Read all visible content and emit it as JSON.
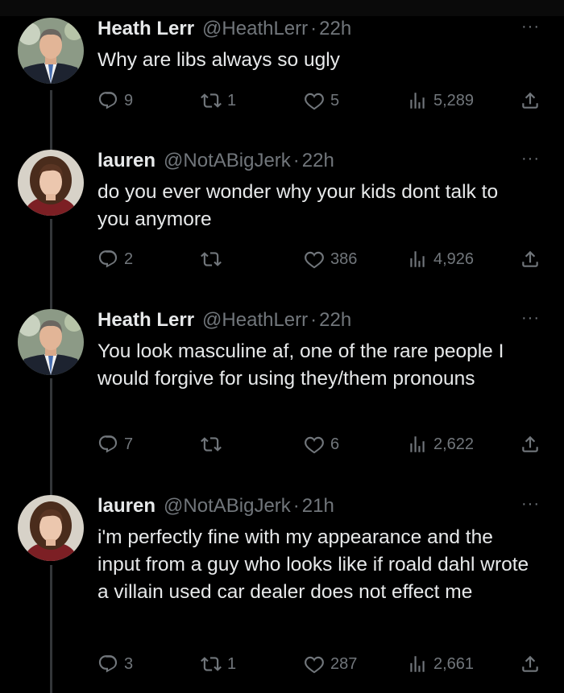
{
  "tweets": [
    {
      "name": "Heath Lerr",
      "handle": "@HeathLerr",
      "separator": "·",
      "time": "22h",
      "more": "···",
      "text": "Why are libs always so ugly",
      "replies": "9",
      "retweets": "1",
      "likes": "5",
      "views": "5,289"
    },
    {
      "name": "lauren",
      "handle": "@NotABigJerk",
      "separator": "·",
      "time": "22h",
      "more": "···",
      "text": "do you ever wonder why your kids dont talk to you anymore",
      "replies": "2",
      "retweets": "",
      "likes": "386",
      "views": "4,926"
    },
    {
      "name": "Heath Lerr",
      "handle": "@HeathLerr",
      "separator": "·",
      "time": "22h",
      "more": "···",
      "text": "You look masculine af, one of the rare people I would forgive for using they/them pronouns",
      "replies": "7",
      "retweets": "",
      "likes": "6",
      "views": "2,622"
    },
    {
      "name": "lauren",
      "handle": "@NotABigJerk",
      "separator": "·",
      "time": "21h",
      "more": "···",
      "text": "i'm perfectly fine with my appearance and the input from a guy who looks like if roald dahl wrote a villain used car dealer does not effect me",
      "replies": "3",
      "retweets": "1",
      "likes": "287",
      "views": "2,661"
    }
  ],
  "colors": {
    "background": "#000000",
    "text": "#e7e9ea",
    "muted": "#71767b",
    "thread_line": "#333639"
  },
  "icons": {
    "reply": "reply-icon",
    "retweet": "retweet-icon",
    "like": "heart-icon",
    "views": "views-icon",
    "share": "share-icon",
    "more": "more-icon"
  }
}
